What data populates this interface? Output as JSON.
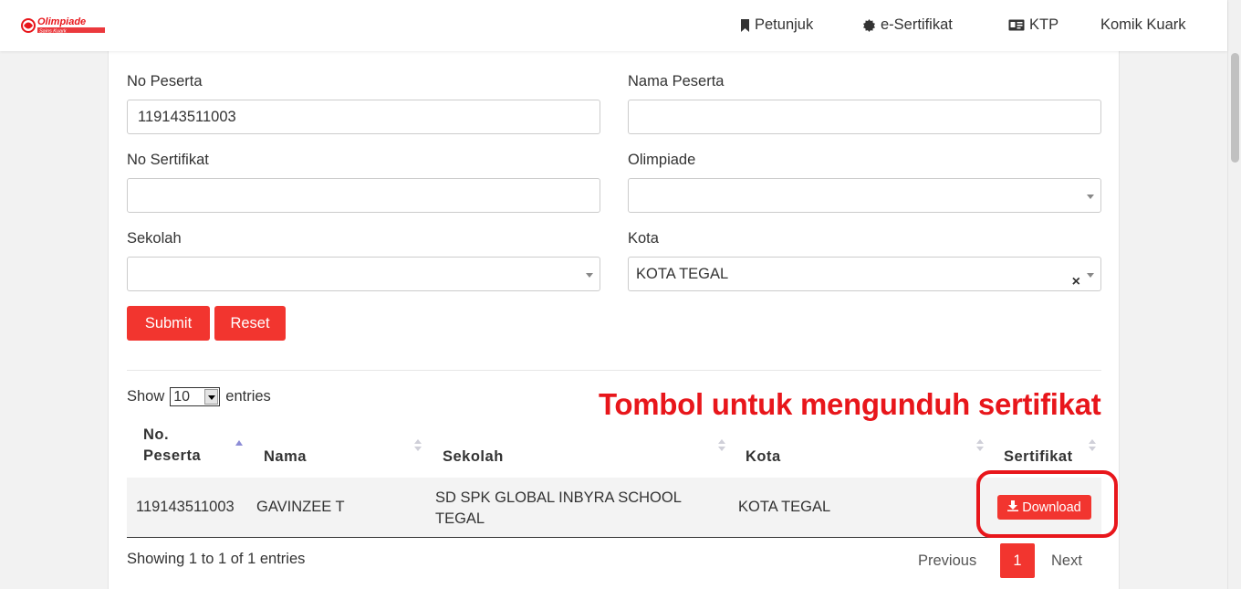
{
  "brand": {
    "logo_alt": "Olimpiade Sains Kuark",
    "logo_color": "#e8161b"
  },
  "nav": {
    "items": [
      {
        "label": "Petunjuk",
        "icon": "bookmark-icon"
      },
      {
        "label": "e-Sertifikat",
        "icon": "certificate-icon"
      },
      {
        "label": "KTP",
        "icon": "id-card-icon"
      },
      {
        "label": "Komik Kuark",
        "icon": ""
      }
    ]
  },
  "form": {
    "no_peserta": {
      "label": "No Peserta",
      "value": "119143511003"
    },
    "nama_peserta": {
      "label": "Nama Peserta",
      "value": ""
    },
    "no_sertifikat": {
      "label": "No Sertifikat",
      "value": ""
    },
    "olimpiade": {
      "label": "Olimpiade",
      "value": ""
    },
    "sekolah": {
      "label": "Sekolah",
      "value": ""
    },
    "kota": {
      "label": "Kota",
      "value": "KOTA TEGAL",
      "clear": "×"
    },
    "submit_label": "Submit",
    "reset_label": "Reset"
  },
  "table": {
    "show_label": "Show",
    "entries_label": "entries",
    "page_length": "10",
    "headers": {
      "no_peserta_line1": "No.",
      "no_peserta_line2": "Peserta",
      "nama": "Nama",
      "sekolah": "Sekolah",
      "kota": "Kota",
      "sertifikat": "Sertifikat"
    },
    "rows": [
      {
        "no_peserta": "119143511003",
        "nama": "GAVINZEE T",
        "sekolah_line1": "SD SPK GLOBAL INBYRA SCHOOL",
        "sekolah_line2": "TEGAL",
        "kota": "KOTA TEGAL",
        "download_label": "Download"
      }
    ],
    "info": "Showing 1 to 1 of 1 entries",
    "pagination": {
      "previous": "Previous",
      "current": "1",
      "next": "Next"
    }
  },
  "annotation": {
    "text": "Tombol untuk mengunduh sertifikat",
    "color": "#e8161b"
  },
  "colors": {
    "accent": "#f2352f"
  }
}
